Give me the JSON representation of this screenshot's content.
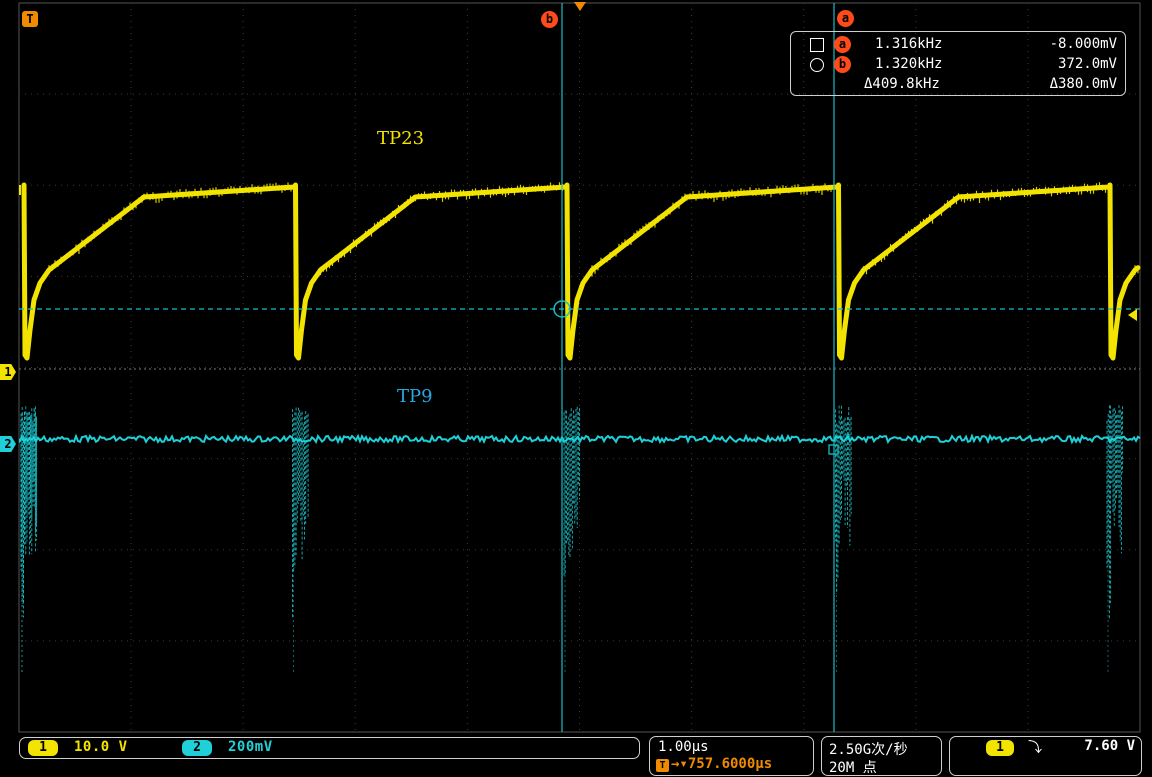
{
  "colors": {
    "ch1": "#f2e400",
    "ch2": "#1fd0d8",
    "cursor": "#19bcc6",
    "marker": "#ff4a1a",
    "trigger": "#f08a00",
    "grid": "#8a8a8a"
  },
  "labels": {
    "tp23": "TP23",
    "tp9": "TP9"
  },
  "cursor_markers": {
    "a": "a",
    "b": "b",
    "trigger_top": "T"
  },
  "channel_markers": {
    "ch1": "1",
    "ch2": "2"
  },
  "readout": {
    "row_a": {
      "symbol_icon": "square-icon",
      "marker": "a",
      "freq": "1.316kHz",
      "value": "-8.000mV"
    },
    "row_b": {
      "symbol_icon": "circle-icon",
      "marker": "b",
      "freq": "1.320kHz",
      "value": "372.0mV"
    },
    "row_delta": {
      "freq": "Δ409.8kHz",
      "value": "Δ380.0mV"
    }
  },
  "status_bar": {
    "ch1_num": "1",
    "ch1_scale": "10.0 V",
    "ch2_num": "2",
    "ch2_scale": "200mV",
    "timebase": "1.00μs",
    "trigger_pos": "→▾757.6000μs",
    "trigger_pos_icon": "T",
    "sample_rate": "2.50G次/秒",
    "record_len": "20M 点",
    "trig_ch": "1",
    "trig_slope_icon": "falling-edge-icon",
    "trig_slope": "⤵",
    "trig_level": "7.60 V"
  }
}
